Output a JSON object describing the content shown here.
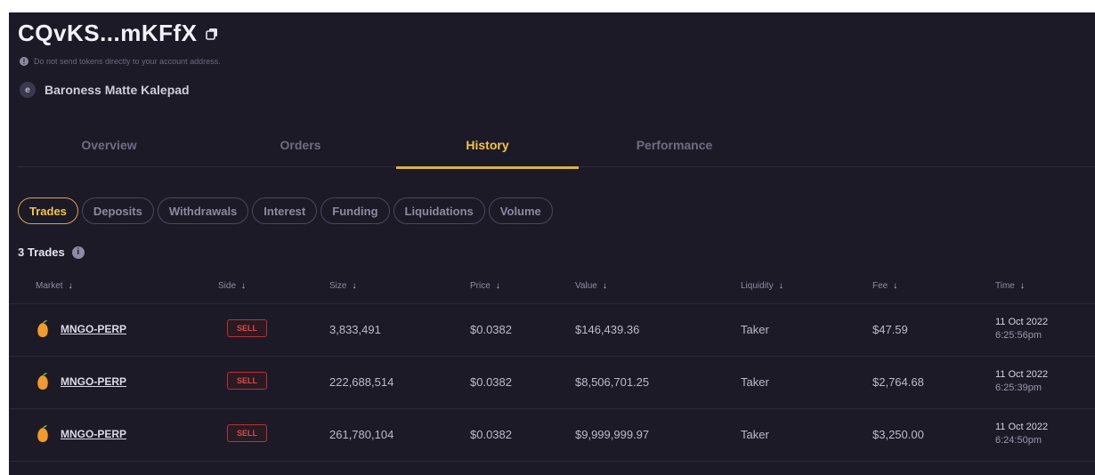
{
  "account": {
    "address": "CQvKS...mKFfX",
    "warning": "Do not send tokens directly to your account address.",
    "profile_name": "Baroness Matte Kalepad"
  },
  "tabs": [
    {
      "label": "Overview"
    },
    {
      "label": "Orders"
    },
    {
      "label": "History",
      "active": true
    },
    {
      "label": "Performance"
    }
  ],
  "filters": [
    {
      "label": "Trades",
      "active": true
    },
    {
      "label": "Deposits"
    },
    {
      "label": "Withdrawals"
    },
    {
      "label": "Interest"
    },
    {
      "label": "Funding"
    },
    {
      "label": "Liquidations"
    },
    {
      "label": "Volume"
    }
  ],
  "trades_count_label": "3 Trades",
  "table": {
    "columns": [
      "Market",
      "Side",
      "Size",
      "Price",
      "Value",
      "Liquidity",
      "Fee",
      "Time"
    ],
    "sort_arrow": "↓",
    "rows": [
      {
        "market": "MNGO-PERP",
        "side": "SELL",
        "size": "3,833,491",
        "price": "$0.0382",
        "value": "$146,439.36",
        "liquidity": "Taker",
        "fee": "$47.59",
        "date": "11 Oct 2022",
        "time": "6:25:56pm"
      },
      {
        "market": "MNGO-PERP",
        "side": "SELL",
        "size": "222,688,514",
        "price": "$0.0382",
        "value": "$8,506,701.25",
        "liquidity": "Taker",
        "fee": "$2,764.68",
        "date": "11 Oct 2022",
        "time": "6:25:39pm"
      },
      {
        "market": "MNGO-PERP",
        "side": "SELL",
        "size": "261,780,104",
        "price": "$0.0382",
        "value": "$9,999,999.97",
        "liquidity": "Taker",
        "fee": "$3,250.00",
        "date": "11 Oct 2022",
        "time": "6:24:50pm"
      }
    ]
  },
  "colors": {
    "background": "#1b1a26",
    "accent": "#f4c542",
    "sell": "#d54a50"
  },
  "icons": {
    "copy": "copy-icon",
    "info": "info-icon",
    "profile": "profile-icon",
    "market": "mango-icon"
  }
}
